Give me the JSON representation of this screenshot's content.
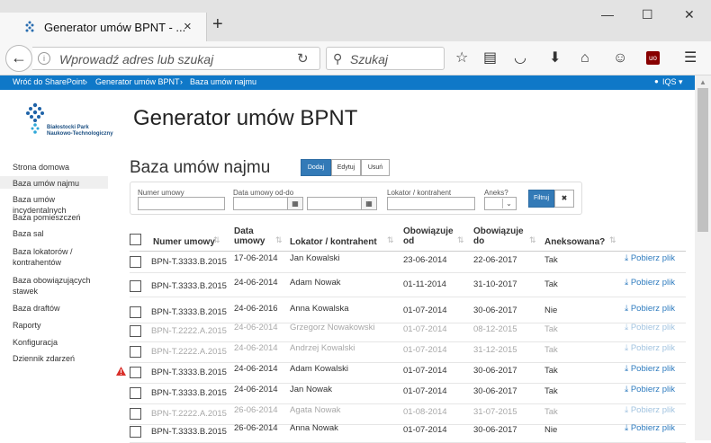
{
  "browser": {
    "tab_title": "Generator umów BPNT - ...",
    "tab_close": "×",
    "new_tab": "+",
    "window_controls": {
      "minimize": "—",
      "maximize": "☐",
      "close": "✕"
    },
    "back": "←",
    "address_placeholder": "Wprowadź adres lub szukaj",
    "reload": "↻",
    "search_placeholder": "Szukaj"
  },
  "sharepoint_bar": {
    "crumbs": [
      "Wróć do SharePoint",
      "Generator umów BPNT",
      "Baza umów najmu"
    ],
    "separator": "›",
    "user": "IQS ▾"
  },
  "logo": {
    "line1": "Białostocki Park",
    "line2": "Naukowo-Technologiczny"
  },
  "app_title": "Generator umów BPNT",
  "nav": [
    "Strona domowa",
    "Baza umów najmu",
    "Baza umów incydentalnych",
    "Baza pomieszczeń",
    "Baza sal",
    "Baza lokatorów / kontrahentów",
    "Baza obowiązujących stawek",
    "Baza draftów",
    "Raporty",
    "Konfiguracja",
    "Dziennik zdarzeń"
  ],
  "nav_selected": 1,
  "page_title": "Baza umów najmu",
  "actions": {
    "add": "Dodaj",
    "edit": "Edytuj",
    "delete": "Usuń"
  },
  "filter": {
    "number_label": "Numer umowy",
    "date_label": "Data umowy od-do",
    "tenant_label": "Lokator / kontrahent",
    "annex_label": "Aneks?",
    "filter_button": "Filtruj",
    "clear_button": "✖"
  },
  "table": {
    "headers": [
      "Numer umowy",
      "Data umowy",
      "Lokator / kontrahent",
      "Obowiązuje od",
      "Obowiązuje do",
      "Aneksowana?"
    ],
    "download_label": "Pobierz plik",
    "rows": [
      {
        "number": "BPN-T.3333.B.2015",
        "date": "17-06-2014",
        "tenant": "Jan Kowalski",
        "from": "23-06-2014",
        "to": "22-06-2017",
        "annex": "Tak",
        "dim": false,
        "warn": false
      },
      {
        "number": "BPN-T.3333.B.2015",
        "date": "24-06-2014",
        "tenant": "Adam Nowak",
        "from": "01-11-2014",
        "to": "31-10-2017",
        "annex": "Tak",
        "dim": false,
        "warn": false
      },
      {
        "number": "BPN-T.3333.B.2015",
        "date": "24-06-2016",
        "tenant": "Anna Kowalska",
        "from": "01-07-2014",
        "to": "30-06-2017",
        "annex": "Nie",
        "dim": false,
        "warn": false
      },
      {
        "number": "BPN-T.2222.A.2015",
        "date": "24-06-2014",
        "tenant": "Grzegorz Nowakowski",
        "from": "01-07-2014",
        "to": "08-12-2015",
        "annex": "Tak",
        "dim": true,
        "warn": false
      },
      {
        "number": "BPN-T.2222.A.2015",
        "date": "24-06-2014",
        "tenant": "Andrzej Kowalski",
        "from": "01-07-2014",
        "to": "31-12-2015",
        "annex": "Tak",
        "dim": true,
        "warn": false
      },
      {
        "number": "BPN-T.3333.B.2015",
        "date": "24-06-2014",
        "tenant": "Adam Kowalski",
        "from": "01-07-2014",
        "to": "30-06-2017",
        "annex": "Tak",
        "dim": false,
        "warn": true
      },
      {
        "number": "BPN-T.3333.B.2015",
        "date": "24-06-2014",
        "tenant": "Jan Nowak",
        "from": "01-07-2014",
        "to": "30-06-2017",
        "annex": "Tak",
        "dim": false,
        "warn": false
      },
      {
        "number": "BPN-T.2222.A.2015",
        "date": "26-06-2014",
        "tenant": "Agata Nowak",
        "from": "01-08-2014",
        "to": "31-07-2015",
        "annex": "Tak",
        "dim": true,
        "warn": false
      },
      {
        "number": "BPN-T.3333.B.2015",
        "date": "26-06-2014",
        "tenant": "Anna Nowak",
        "from": "01-07-2014",
        "to": "30-06-2017",
        "annex": "Nie",
        "dim": false,
        "warn": false
      }
    ]
  },
  "colors": {
    "accent": "#0f78c8",
    "primary_button": "#337ab7",
    "link": "#2f7cbf",
    "warning": "#d9302b"
  }
}
